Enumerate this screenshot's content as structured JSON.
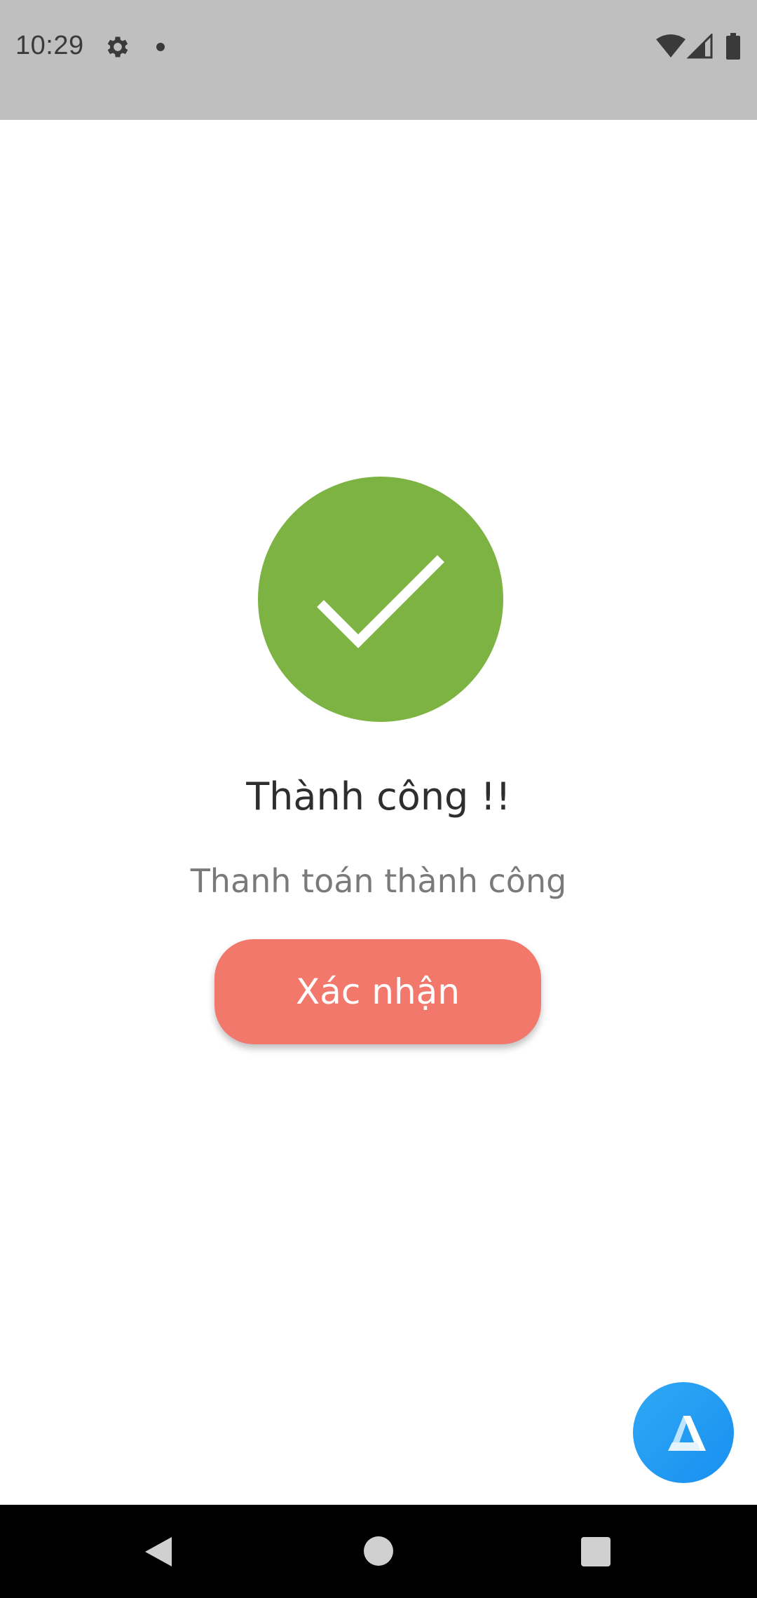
{
  "status_bar": {
    "time": "10:29",
    "icons": [
      "gear-icon",
      "notification-dot-icon",
      "wifi-icon",
      "cellular-signal-icon",
      "battery-icon"
    ]
  },
  "content": {
    "title": "Thành công !!",
    "subtitle": "Thanh toán thành công",
    "confirm_label": "Xác nhận"
  },
  "floating_button": {
    "icon": "app-logo-icon"
  },
  "nav_bar": {
    "icons": [
      "back-icon",
      "home-icon",
      "recents-icon"
    ]
  },
  "colors": {
    "status_bar": "#bfbfbf",
    "success": "#7cb342",
    "button": "#f2786c",
    "fab": "#1e98f2",
    "nav_bar": "#000000"
  }
}
